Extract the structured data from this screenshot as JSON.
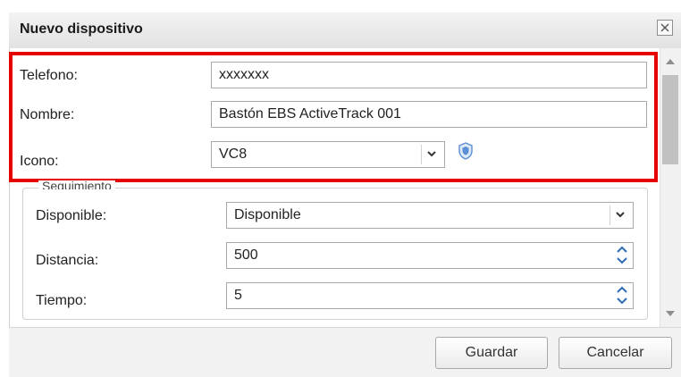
{
  "dialog": {
    "title": "Nuevo dispositivo",
    "close_icon": "close-icon"
  },
  "form": {
    "telefono": {
      "label": "Telefono:",
      "value": "xxxxxxx"
    },
    "nombre": {
      "label": "Nombre:",
      "value": "Bastón EBS ActiveTrack 001"
    },
    "icono": {
      "label": "Icono:",
      "value": "VC8",
      "preview_icon": "shield-icon"
    }
  },
  "seguimiento": {
    "legend": "Seguimiento",
    "disponible": {
      "label": "Disponible:",
      "value": "Disponible"
    },
    "distancia": {
      "label": "Distancia:",
      "value": "500"
    },
    "tiempo": {
      "label": "Tiempo:",
      "value": "5"
    }
  },
  "buttons": {
    "save": "Guardar",
    "cancel": "Cancelar"
  },
  "colors": {
    "highlight": "#e60000",
    "titlebar": "#e8e8e8",
    "icon_blue": "#5b8fd6"
  }
}
